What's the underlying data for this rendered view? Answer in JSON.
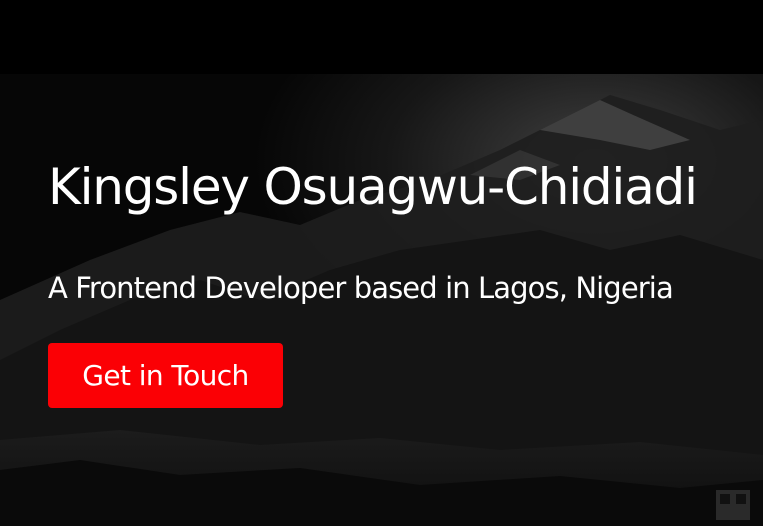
{
  "hero": {
    "title": "Kingsley Osuagwu-Chidiadi",
    "subtitle": "A Frontend Developer based in Lagos, Nigeria",
    "cta_label": "Get in Touch"
  },
  "colors": {
    "background": "#050505",
    "text": "#ffffff",
    "accent": "#fb0005"
  }
}
